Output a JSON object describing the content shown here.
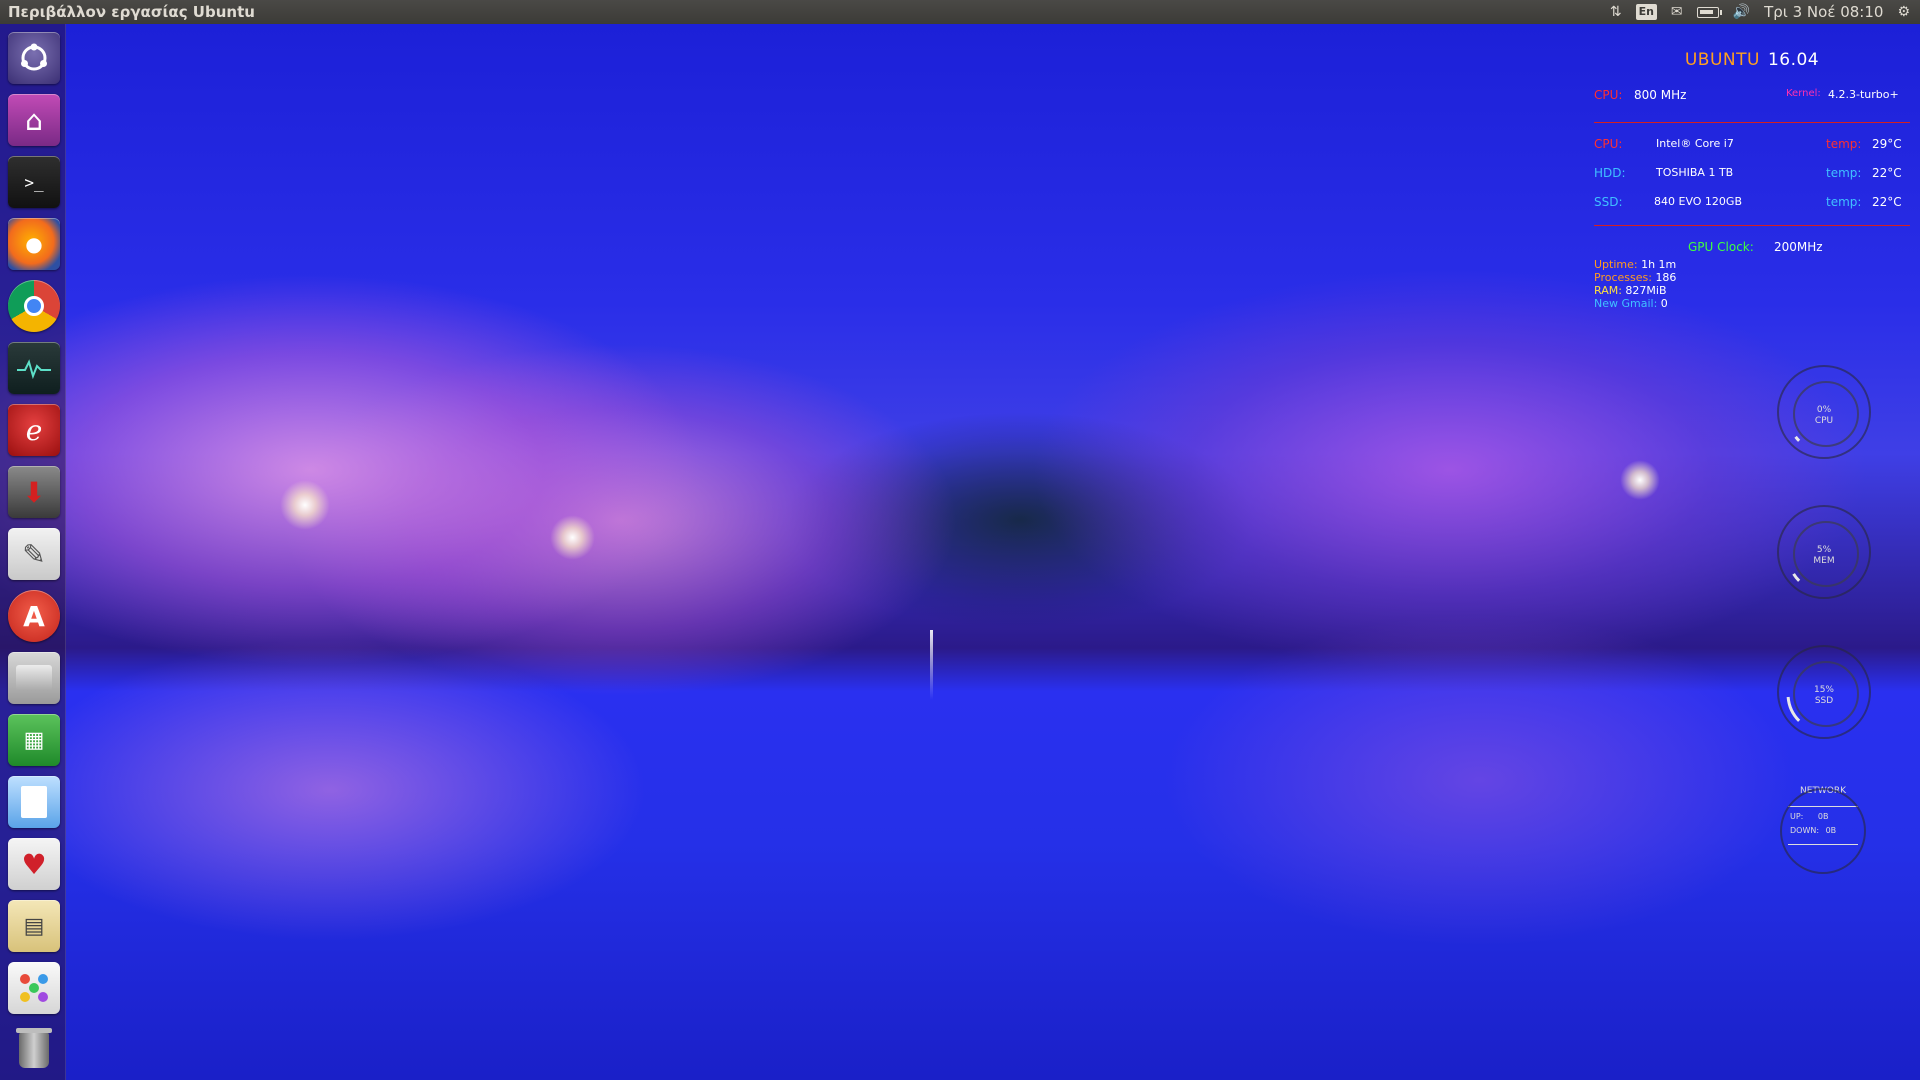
{
  "top_panel": {
    "title": "Περιβάλλον εργασίας Ubuntu",
    "tray": {
      "network_icon": "updown-arrows-icon",
      "keyboard_lang": "En",
      "mail_icon": "envelope-icon",
      "battery_icon": "battery-icon",
      "sound_icon": "speaker-icon",
      "settings_icon": "gear-icon"
    },
    "clock": "Τρι 3 Νοέ 08:10"
  },
  "launcher": {
    "items": [
      {
        "name": "dash",
        "icon": "ubuntu-logo-icon"
      },
      {
        "name": "files",
        "icon": "home-folder-icon"
      },
      {
        "name": "terminal",
        "icon": "terminal-icon"
      },
      {
        "name": "firefox",
        "icon": "firefox-icon"
      },
      {
        "name": "chrome",
        "icon": "chrome-icon"
      },
      {
        "name": "system-monitor",
        "icon": "heartbeat-icon"
      },
      {
        "name": "eclipse",
        "icon": "e-logo-icon"
      },
      {
        "name": "transmission",
        "icon": "download-arrow-icon"
      },
      {
        "name": "text-editor",
        "icon": "pen-icon"
      },
      {
        "name": "software-center",
        "icon": "software-a-icon"
      },
      {
        "name": "drive",
        "icon": "drive-icon"
      },
      {
        "name": "spreadsheet",
        "icon": "spreadsheet-icon"
      },
      {
        "name": "writer",
        "icon": "document-icon"
      },
      {
        "name": "solitaire",
        "icon": "playing-cards-icon"
      },
      {
        "name": "mahjongg",
        "icon": "tiles-icon"
      },
      {
        "name": "flow-game",
        "icon": "dots-icon"
      },
      {
        "name": "trash",
        "icon": "trash-icon"
      }
    ]
  },
  "conky": {
    "os_name": "UBUNTU",
    "os_version": "16.04",
    "cpu_label": "CPU:",
    "cpu_freq": "800 MHz",
    "kernel_label": "Kernel:",
    "kernel_value": "4.2.3-turbo+",
    "hw": [
      {
        "label": "CPU:",
        "model": "Intel® Core i7",
        "temp_label": "temp:",
        "temp": "29°C",
        "label_color": "#ff3030"
      },
      {
        "label": "HDD:",
        "model": "TOSHIBA  1 TB",
        "temp_label": "temp:",
        "temp": "22°C",
        "label_color": "#40c0ff"
      },
      {
        "label": "SSD:",
        "model": "840 EVO  120GB",
        "temp_label": "temp:",
        "temp": "22°C",
        "label_color": "#40c0ff"
      }
    ],
    "gpu_label": "GPU Clock:",
    "gpu_value": "200MHz",
    "uptime_label": "Uptime:",
    "uptime_value": "1h 1m",
    "processes_label": "Processes:",
    "processes_value": "186",
    "ram_label": "RAM:",
    "ram_value": "827MiB",
    "gmail_label": "New Gmail:",
    "gmail_value": "0",
    "gauges": [
      {
        "label": "CPU",
        "percent_text": "0%",
        "percent": 0
      },
      {
        "label": "MEM",
        "percent_text": "5%",
        "percent": 5
      },
      {
        "label": "SSD",
        "percent_text": "15%",
        "percent": 15
      }
    ],
    "network": {
      "title": "NETWORK",
      "up_label": "UP:",
      "up_value": "0B",
      "down_label": "DOWN:",
      "down_value": "0B"
    }
  }
}
